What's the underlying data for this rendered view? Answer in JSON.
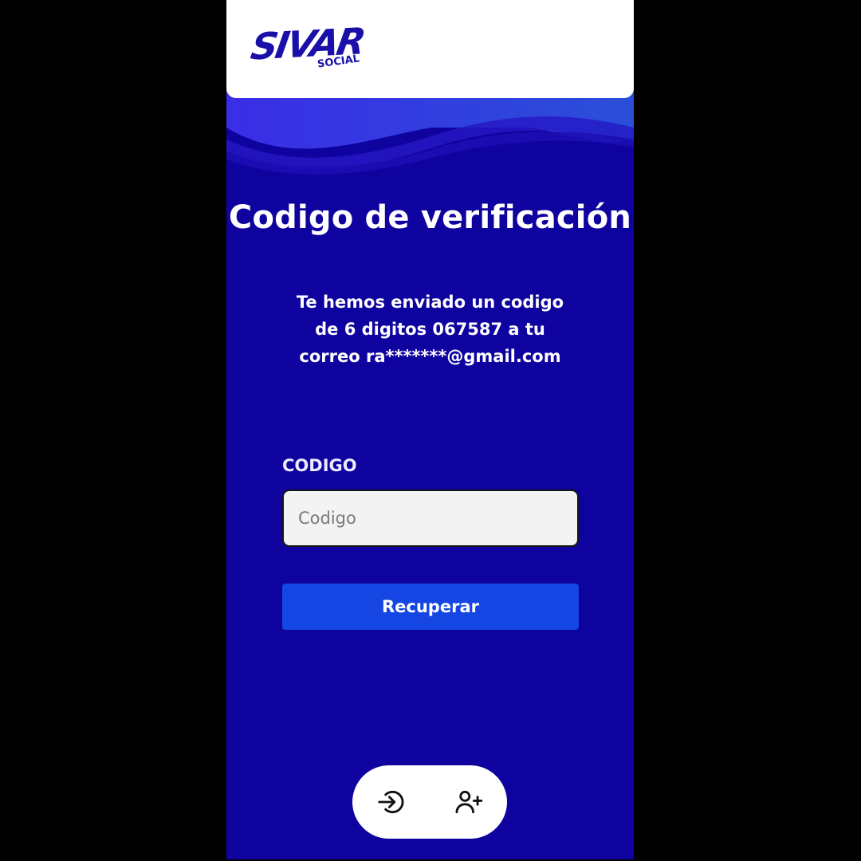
{
  "brand": {
    "logo_text": "SIVAR",
    "logo_subtext": "SOCIAL",
    "color": "#1a0fa8"
  },
  "colors": {
    "background": "#0f039f",
    "button": "#1546e3",
    "header": "#ffffff"
  },
  "page": {
    "title": "Codigo de verificación",
    "message_line1": "Te hemos enviado un codigo",
    "message_line2": "de 6 digitos 067587 a tu",
    "message_line3": "correo ra*******@gmail.com"
  },
  "form": {
    "code_label": "CODIGO",
    "code_placeholder": "Codigo",
    "code_value": "",
    "submit_label": "Recuperar"
  },
  "bottom_nav": {
    "items": [
      {
        "icon": "login-arrow-icon"
      },
      {
        "icon": "user-plus-icon"
      }
    ]
  }
}
